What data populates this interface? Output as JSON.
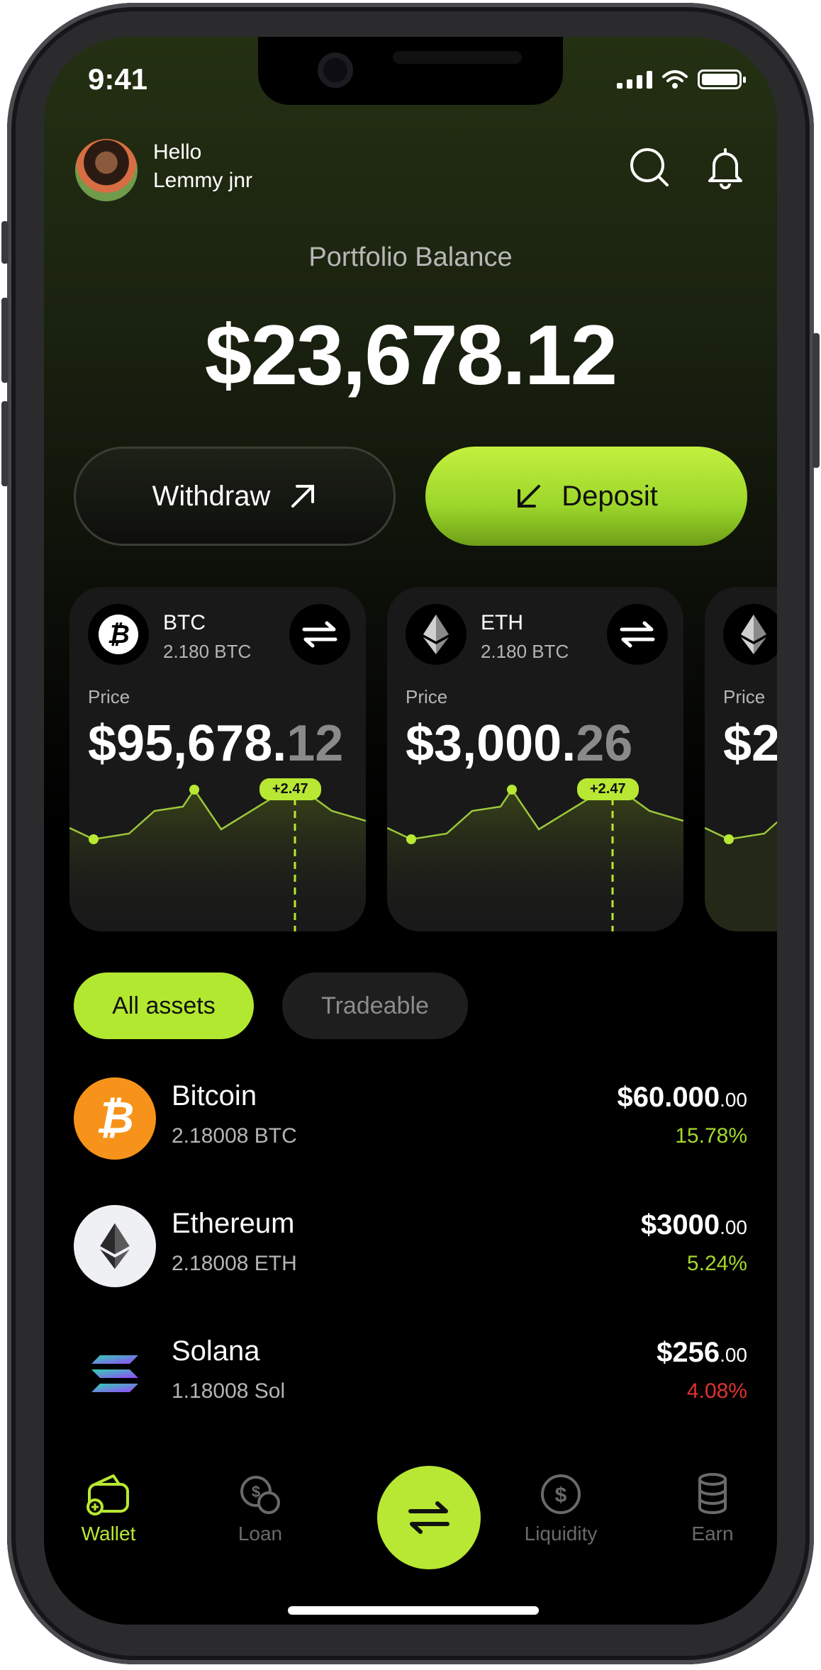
{
  "status_bar": {
    "time": "9:41"
  },
  "header": {
    "greeting": "Hello",
    "user_name": "Lemmy jnr"
  },
  "portfolio": {
    "label": "Portfolio Balance",
    "balance": "$23,678.12"
  },
  "actions": {
    "withdraw_label": "Withdraw",
    "deposit_label": "Deposit"
  },
  "cards": [
    {
      "symbol": "BTC",
      "amount": "2.180 BTC",
      "price_label": "Price",
      "price_main": "$95,678.",
      "price_dec": "12",
      "change": "+2.47",
      "icon": "bitcoin-icon"
    },
    {
      "symbol": "ETH",
      "amount": "2.180 BTC",
      "price_label": "Price",
      "price_main": "$3,000.",
      "price_dec": "26",
      "change": "+2.47",
      "icon": "ethereum-icon"
    },
    {
      "price_label": "Price",
      "price_main": "$2",
      "icon": "ethereum-icon"
    }
  ],
  "tabs": {
    "all": "All assets",
    "tradeable": "Tradeable"
  },
  "assets": [
    {
      "name": "Bitcoin",
      "amount": "2.18008 BTC",
      "value_main": "$60.000",
      "value_dec": ".00",
      "change": "15.78%",
      "trend": "up",
      "icon": "bitcoin-icon"
    },
    {
      "name": "Ethereum",
      "amount": "2.18008 ETH",
      "value_main": "$3000",
      "value_dec": ".00",
      "change": "5.24%",
      "trend": "up",
      "icon": "ethereum-icon"
    },
    {
      "name": "Solana",
      "amount": "1.18008 Sol",
      "value_main": "$256",
      "value_dec": ".00",
      "change": "4.08%",
      "trend": "down",
      "icon": "solana-icon"
    }
  ],
  "nav": {
    "wallet": "Wallet",
    "loan": "Loan",
    "liquidity": "Liquidity",
    "earn": "Earn"
  },
  "colors": {
    "accent": "#b8e833",
    "up": "#a3d82a",
    "down": "#e0322f",
    "bitcoin": "#f7931a"
  }
}
